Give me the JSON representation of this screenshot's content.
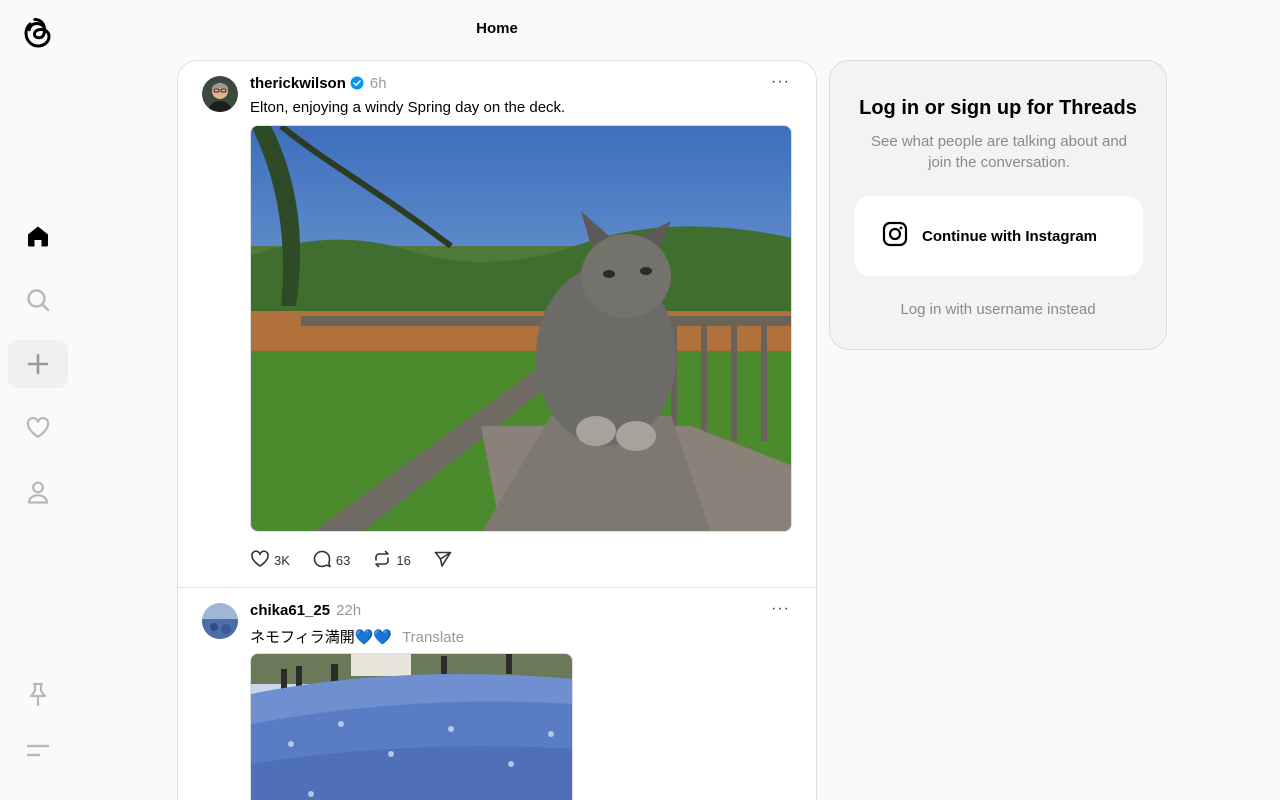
{
  "header": {
    "title": "Home"
  },
  "sidebar": {
    "items": [
      {
        "name": "home",
        "icon": "home-icon",
        "active": true
      },
      {
        "name": "search",
        "icon": "search-icon"
      },
      {
        "name": "create",
        "icon": "plus-icon"
      },
      {
        "name": "activity",
        "icon": "heart-icon"
      },
      {
        "name": "profile",
        "icon": "person-icon"
      }
    ],
    "bottom": [
      {
        "name": "pinned",
        "icon": "pin-icon"
      },
      {
        "name": "menu",
        "icon": "menu-icon"
      }
    ]
  },
  "posts": [
    {
      "username": "therickwilson",
      "verified": true,
      "time": "6h",
      "caption": "Elton, enjoying a windy Spring day on the deck.",
      "likes": "3K",
      "replies": "63",
      "reposts": "16"
    },
    {
      "username": "chika61_25",
      "verified": false,
      "time": "22h",
      "caption": "ネモフィラ満開💙💙",
      "translate_label": "Translate"
    }
  ],
  "login": {
    "title": "Log in or sign up for Threads",
    "subtitle": "See what people are talking about and join the conversation.",
    "instagram_button": "Continue with Instagram",
    "alt_login": "Log in with username instead"
  },
  "colors": {
    "background": "#fafafa",
    "card": "#f3f3f3",
    "verified": "#0095f6",
    "muted": "#999999"
  }
}
